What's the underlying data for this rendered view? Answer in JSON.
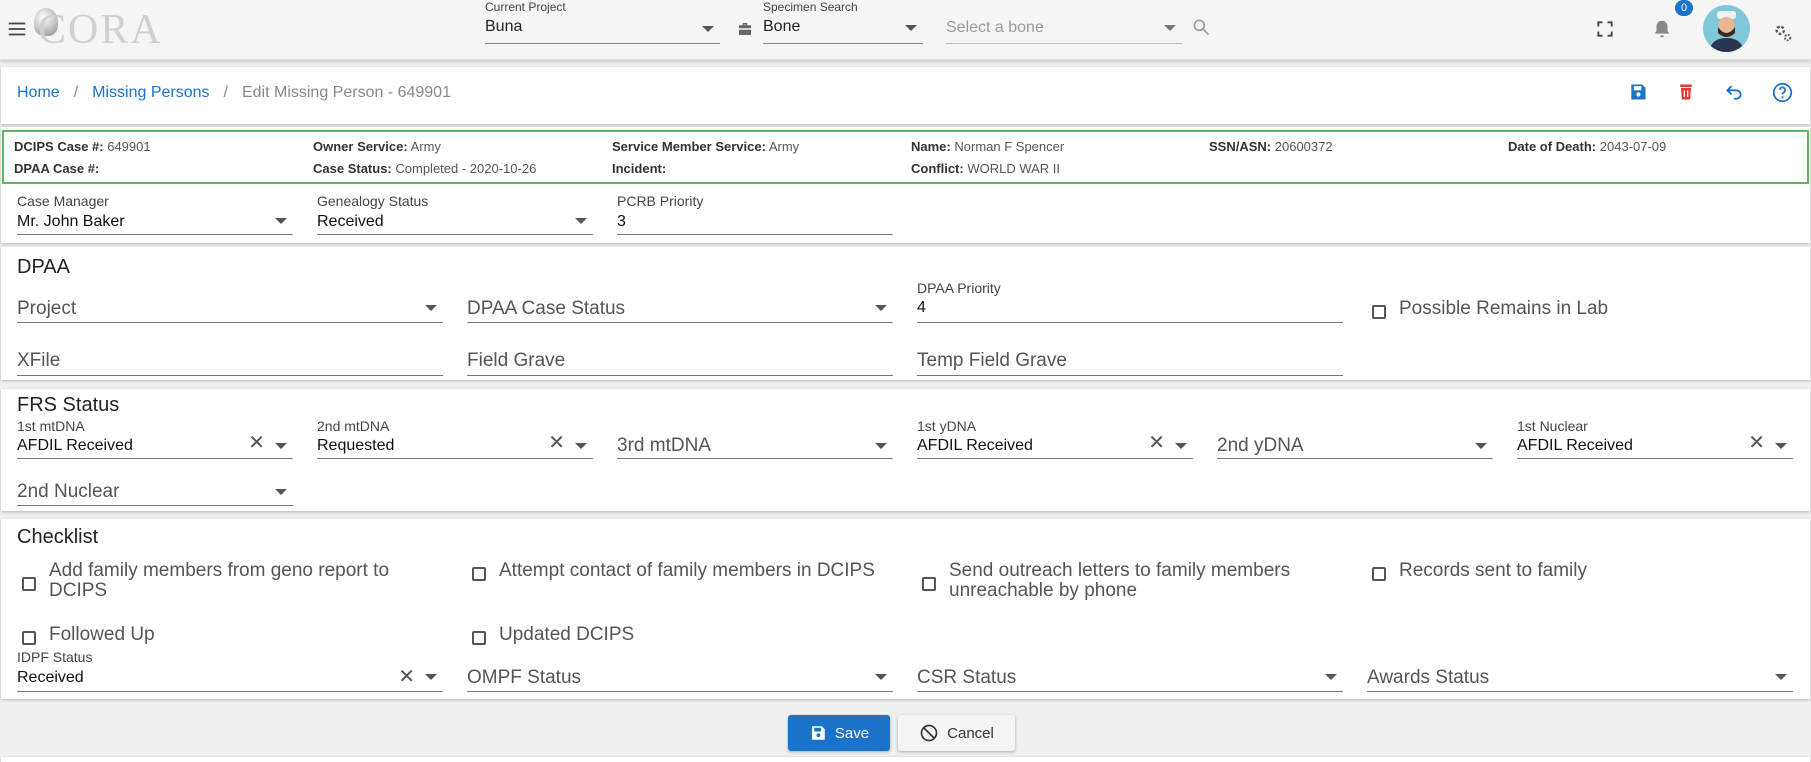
{
  "header": {
    "logo_text": "CORA",
    "current_project": {
      "label": "Current Project",
      "value": "Buna"
    },
    "specimen_search": {
      "label": "Specimen Search",
      "value": "Bone"
    },
    "bone_select": {
      "placeholder": "Select a bone"
    },
    "notification_count": "0"
  },
  "breadcrumb": {
    "home": "Home",
    "missing_persons": "Missing Persons",
    "current": "Edit Missing Person - 649901",
    "separator": "/"
  },
  "summary": {
    "dcips_case": {
      "label": "DCIPS Case #:",
      "value": "649901"
    },
    "dpaa_case": {
      "label": "DPAA Case #:",
      "value": ""
    },
    "owner_service": {
      "label": "Owner Service:",
      "value": "Army"
    },
    "case_status": {
      "label": "Case Status:",
      "value": "Completed - 2020-10-26"
    },
    "service_member_service": {
      "label": "Service Member Service:",
      "value": "Army"
    },
    "incident": {
      "label": "Incident:",
      "value": ""
    },
    "name": {
      "label": "Name:",
      "value": "Norman F Spencer"
    },
    "conflict": {
      "label": "Conflict:",
      "value": "WORLD WAR II"
    },
    "ssn": {
      "label": "SSN/ASN:",
      "value": "20600372"
    },
    "date_of_death": {
      "label": "Date of Death:",
      "value": "2043-07-09"
    }
  },
  "general": {
    "case_manager": {
      "label": "Case Manager",
      "value": "Mr. John Baker"
    },
    "genealogy_status": {
      "label": "Genealogy Status",
      "value": "Received"
    },
    "pcrb_priority": {
      "label": "PCRB Priority",
      "value": "3"
    }
  },
  "dpaa": {
    "title": "DPAA",
    "project": "Project",
    "case_status": "DPAA Case Status",
    "priority": {
      "label": "DPAA Priority",
      "value": "4"
    },
    "possible_remains": "Possible Remains in Lab",
    "xfile": "XFile",
    "field_grave": "Field Grave",
    "temp_field_grave": "Temp Field Grave"
  },
  "frs": {
    "title": "FRS Status",
    "mtdna1": {
      "label": "1st mtDNA",
      "value": "AFDIL Received"
    },
    "mtdna2": {
      "label": "2nd mtDNA",
      "value": "Requested"
    },
    "mtdna3": "3rd mtDNA",
    "ydna1": {
      "label": "1st yDNA",
      "value": "AFDIL Received"
    },
    "ydna2": "2nd yDNA",
    "nuclear1": {
      "label": "1st Nuclear",
      "value": "AFDIL Received"
    },
    "nuclear2": "2nd Nuclear"
  },
  "checklist": {
    "title": "Checklist",
    "items": [
      "Add family members from geno report to DCIPS",
      "Attempt contact of family members in DCIPS",
      "Send outreach letters to family members unreachable by phone",
      "Records sent to family",
      "Followed Up",
      "Updated DCIPS"
    ],
    "idpf": {
      "label": "IDPF Status",
      "value": "Received"
    },
    "ompf": "OMPF Status",
    "csr": "CSR Status",
    "awards": "Awards Status"
  },
  "actions": {
    "save": "Save",
    "cancel": "Cancel"
  },
  "colors": {
    "primary": "#1a73c8",
    "delete": "#e53935",
    "border_ok": "#5cb85c"
  }
}
